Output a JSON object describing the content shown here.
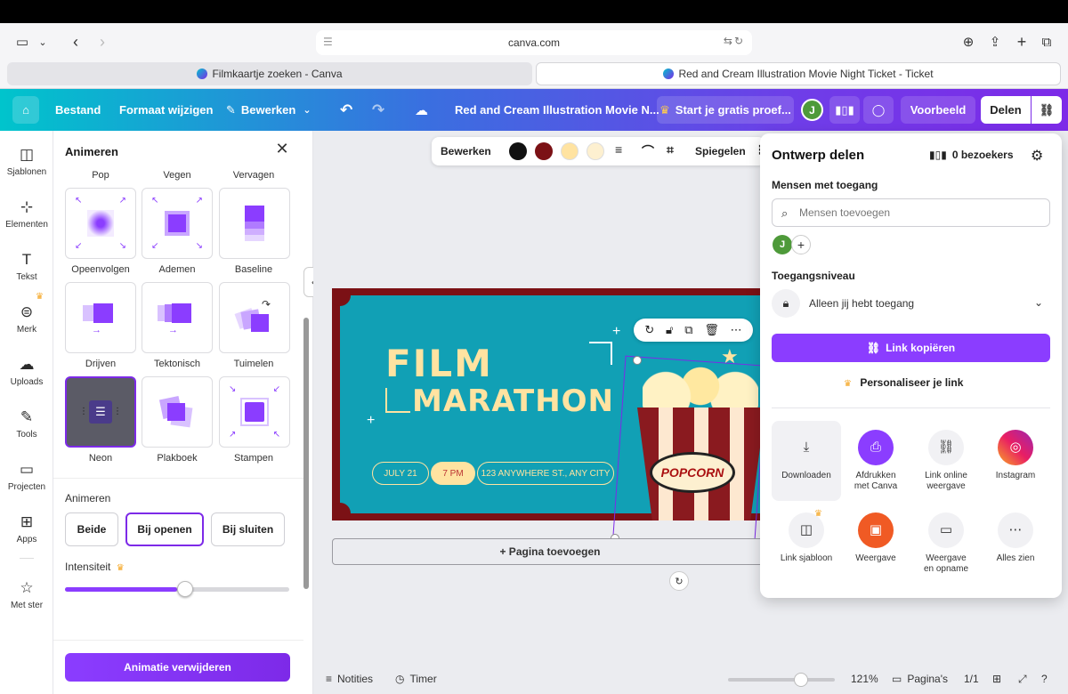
{
  "browser": {
    "url": "canva.com",
    "tabs": [
      {
        "title": "Filmkaartje zoeken - Canva"
      },
      {
        "title": "Red and Cream Illustration Movie Night Ticket - Ticket"
      }
    ]
  },
  "header": {
    "menu": [
      "Bestand",
      "Formaat wijzigen",
      "Bewerken"
    ],
    "doc_title": "Red and Cream Illustration Movie N...",
    "trial": "Start je gratis proef...",
    "avatar": "J",
    "preview": "Voorbeeld",
    "share": "Delen"
  },
  "rail": [
    {
      "label": "Sjablonen",
      "icon": "templates-icon"
    },
    {
      "label": "Elementen",
      "icon": "elements-icon"
    },
    {
      "label": "Tekst",
      "icon": "text-icon"
    },
    {
      "label": "Merk",
      "icon": "brand-icon"
    },
    {
      "label": "Uploads",
      "icon": "upload-icon"
    },
    {
      "label": "Tools",
      "icon": "tools-icon"
    },
    {
      "label": "Projecten",
      "icon": "folder-icon"
    },
    {
      "label": "Apps",
      "icon": "apps-icon"
    },
    {
      "label": "Met ster",
      "icon": "star-icon"
    }
  ],
  "panel": {
    "title": "Animeren",
    "top_labels": [
      "Pop",
      "Vegen",
      "Vervagen"
    ],
    "tiles": [
      "Opeenvolgen",
      "Ademen",
      "Baseline",
      "Drijven",
      "Tektonisch",
      "Tuimelen",
      "Neon",
      "Plakboek",
      "Stampen"
    ],
    "animate_label": "Animeren",
    "animate_options": [
      "Beide",
      "Bij openen",
      "Bij sluiten"
    ],
    "intensity_label": "Intensiteit",
    "intensity_value": 0.5,
    "delete_label": "Animatie verwijderen"
  },
  "context_toolbar": {
    "edit": "Bewerken",
    "colors": [
      "#111111",
      "#7b1115",
      "#ffe3a1",
      "#fdf0d0"
    ],
    "mirror": "Spiegelen"
  },
  "ticket": {
    "line1": "FILM",
    "line2": "MARATHON",
    "date": "JULY 21",
    "time": "7 PM",
    "address": "123 ANYWHERE ST., ANY CITY",
    "popcorn": "POPCORN",
    "colors": {
      "frame": "#7b1115",
      "bg": "#11a0b5",
      "cream": "#ffe3a1"
    }
  },
  "add_page": "+ Pagina toevoegen",
  "bottom": {
    "notes": "Notities",
    "timer": "Timer",
    "zoom": "121%",
    "pages_label": "Pagina's",
    "page_count": "1/1"
  },
  "share": {
    "title": "Ontwerp delen",
    "visitors": "0 bezoekers",
    "people_label": "Mensen met toegang",
    "people_placeholder": "Mensen toevoegen",
    "avatar": "J",
    "access_label": "Toegangsniveau",
    "access_value": "Alleen jij hebt toegang",
    "copy_link": "Link kopiëren",
    "personalize": "Personaliseer je link",
    "options": [
      [
        "Downloaden"
      ],
      [
        "Afdrukken",
        "met Canva"
      ],
      [
        "Link online",
        "weergave"
      ],
      [
        "Instagram"
      ],
      [
        "Link sjabloon"
      ],
      [
        "Weergave"
      ],
      [
        "Weergave",
        "en opname"
      ],
      [
        "Alles zien"
      ]
    ]
  }
}
